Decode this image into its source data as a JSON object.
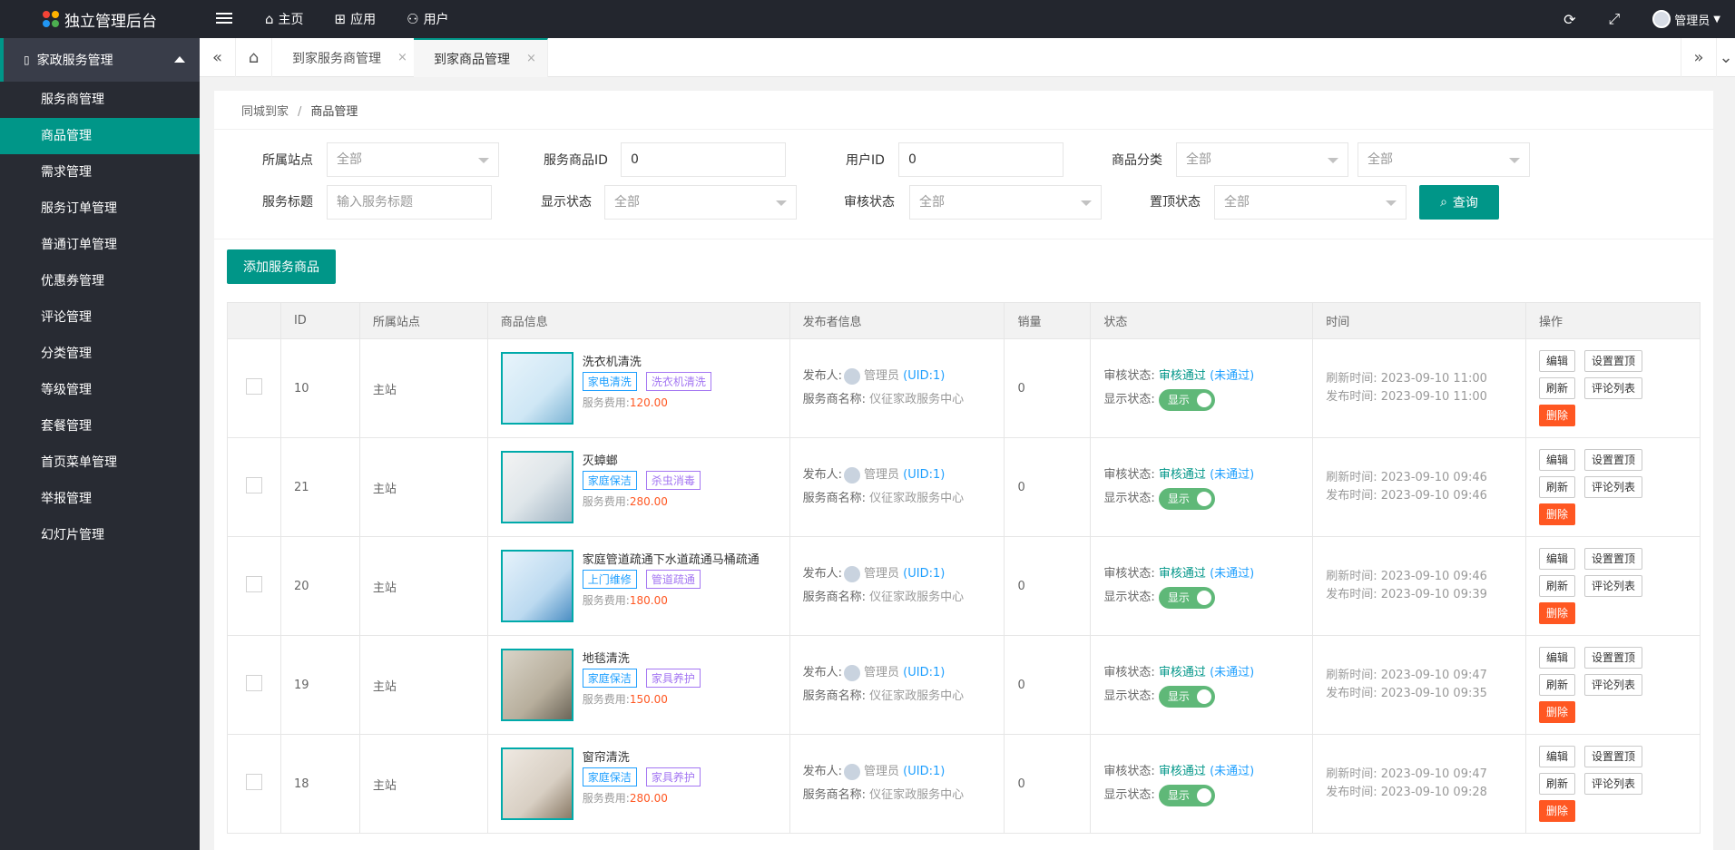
{
  "app": {
    "title": "独立管理后台",
    "logo_colors": [
      "#f44336",
      "#ffb300",
      "#2196f3",
      "#4caf50"
    ]
  },
  "topnav": [
    {
      "icon": "home-icon",
      "label": "主页"
    },
    {
      "icon": "apps-icon",
      "label": "应用"
    },
    {
      "icon": "user-icon",
      "label": "用户"
    }
  ],
  "admin": {
    "label": "管理员"
  },
  "sidebar": {
    "group": "家政服务管理",
    "items": [
      {
        "label": "服务商管理"
      },
      {
        "label": "商品管理",
        "active": true
      },
      {
        "label": "需求管理"
      },
      {
        "label": "服务订单管理"
      },
      {
        "label": "普通订单管理"
      },
      {
        "label": "优惠券管理"
      },
      {
        "label": "评论管理"
      },
      {
        "label": "分类管理"
      },
      {
        "label": "等级管理"
      },
      {
        "label": "套餐管理"
      },
      {
        "label": "首页菜单管理"
      },
      {
        "label": "举报管理"
      },
      {
        "label": "幻灯片管理"
      }
    ]
  },
  "tabs": [
    {
      "label": "到家服务商管理",
      "close": "×"
    },
    {
      "label": "到家商品管理",
      "close": "×",
      "active": true
    }
  ],
  "breadcrumb": {
    "parent": "同城到家",
    "sep": "/",
    "current": "商品管理"
  },
  "filters": {
    "site_label": "所属站点",
    "site_value": "全部",
    "goods_id_label": "服务商品ID",
    "goods_id_value": "0",
    "user_id_label": "用户ID",
    "user_id_value": "0",
    "category_label": "商品分类",
    "category_value1": "全部",
    "category_value2": "全部",
    "title_label": "服务标题",
    "title_placeholder": "输入服务标题",
    "display_label": "显示状态",
    "display_value": "全部",
    "audit_label": "审核状态",
    "audit_value": "全部",
    "top_label": "置顶状态",
    "top_value": "全部",
    "query_label": "查询"
  },
  "add_button": "添加服务商品",
  "table": {
    "headers": [
      "",
      "ID",
      "所属站点",
      "商品信息",
      "发布者信息",
      "销量",
      "状态",
      "时间",
      "操作"
    ],
    "labels": {
      "publisher": "发布人:",
      "provider": "服务商名称:",
      "fee": "服务费用:",
      "audit": "审核状态:",
      "display": "显示状态:",
      "refresh": "刷新时间:",
      "publish": "发布时间:",
      "audit_ok": "审核通过",
      "audit_ng": "(未通过)",
      "display_on": "显示",
      "edit": "编辑",
      "set_top": "设置置顶",
      "refresh_btn": "刷新",
      "comments": "评论列表",
      "delete": "删除"
    },
    "rows": [
      {
        "id": "10",
        "site": "主站",
        "name": "洗衣机清洗",
        "tag1": "家电清洗",
        "tag2": "洗衣机清洗",
        "fee": "120.00",
        "publisher": "管理员",
        "uid": "(UID:1)",
        "provider": "仪征家政服务中心",
        "sales": "0",
        "refresh": "2023-09-10 11:00",
        "publish": "2023-09-10 11:00"
      },
      {
        "id": "21",
        "site": "主站",
        "name": "灭蟑螂",
        "tag1": "家庭保洁",
        "tag2": "杀虫消毒",
        "fee": "280.00",
        "publisher": "管理员",
        "uid": "(UID:1)",
        "provider": "仪征家政服务中心",
        "sales": "0",
        "refresh": "2023-09-10 09:46",
        "publish": "2023-09-10 09:46"
      },
      {
        "id": "20",
        "site": "主站",
        "name": "家庭管道疏通下水道疏通马桶疏通",
        "tag1": "上门维修",
        "tag2": "管道疏通",
        "fee": "180.00",
        "publisher": "管理员",
        "uid": "(UID:1)",
        "provider": "仪征家政服务中心",
        "sales": "0",
        "refresh": "2023-09-10 09:46",
        "publish": "2023-09-10 09:39"
      },
      {
        "id": "19",
        "site": "主站",
        "name": "地毯清洗",
        "tag1": "家庭保洁",
        "tag2": "家具养护",
        "fee": "150.00",
        "publisher": "管理员",
        "uid": "(UID:1)",
        "provider": "仪征家政服务中心",
        "sales": "0",
        "refresh": "2023-09-10 09:47",
        "publish": "2023-09-10 09:35"
      },
      {
        "id": "18",
        "site": "主站",
        "name": "窗帘清洗",
        "tag1": "家庭保洁",
        "tag2": "家具养护",
        "fee": "280.00",
        "publisher": "管理员",
        "uid": "(UID:1)",
        "provider": "仪征家政服务中心",
        "sales": "0",
        "refresh": "2023-09-10 09:47",
        "publish": "2023-09-10 09:28"
      }
    ]
  }
}
